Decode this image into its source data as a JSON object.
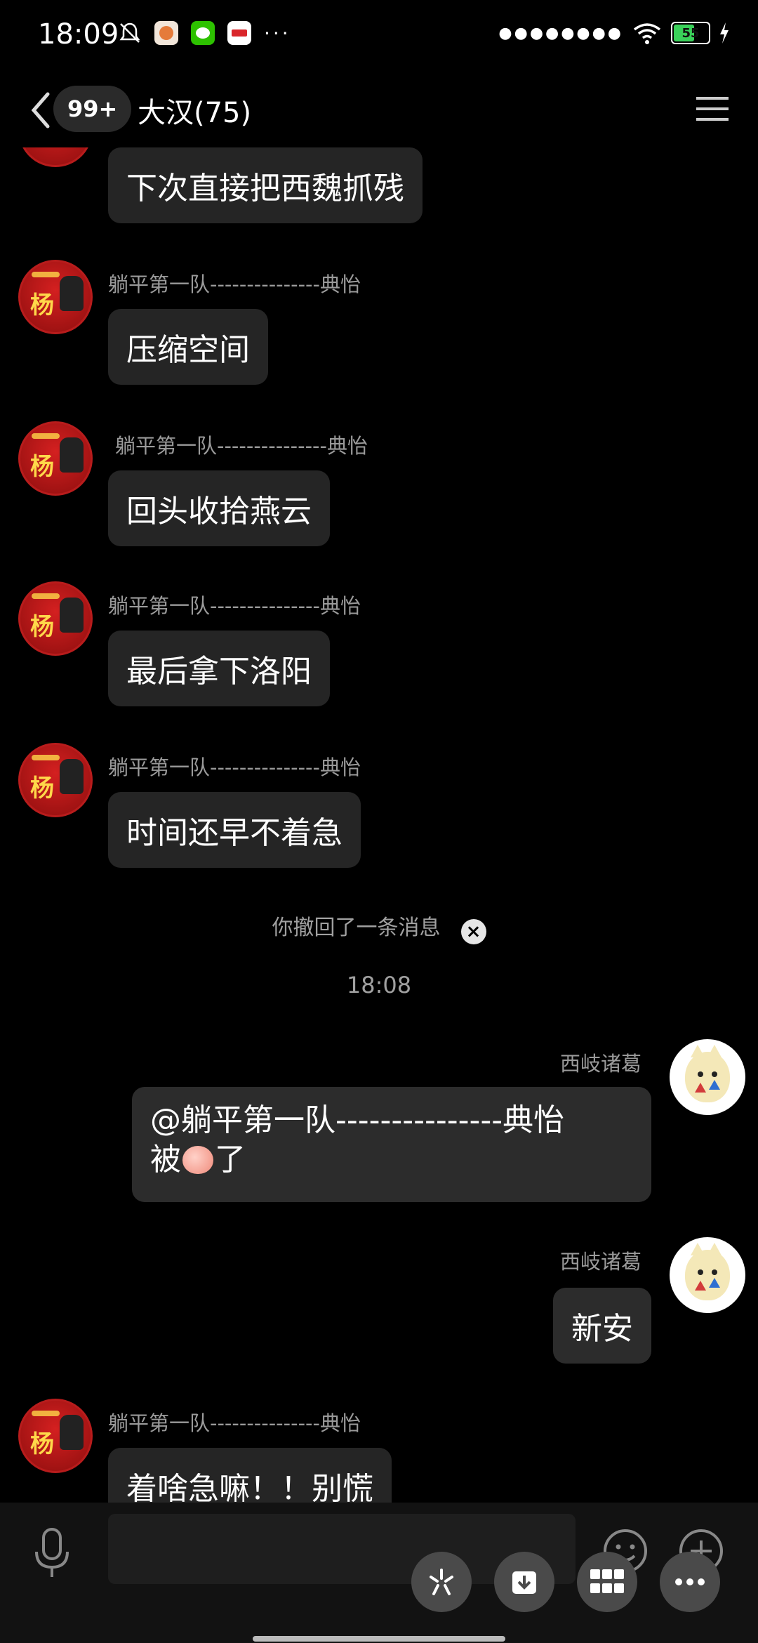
{
  "status_bar": {
    "time": "18:09",
    "battery": "55",
    "colors": {
      "battery_fill": "#3ad15a"
    }
  },
  "header": {
    "unread": "99+",
    "title": "大汉(75)"
  },
  "messages": [
    {
      "sender": "",
      "text": "下次直接把西魏抓残"
    },
    {
      "sender": "躺平第一队---------------典怡",
      "text": "压缩空间"
    },
    {
      "sender": "躺平第一队---------------典怡",
      "text": "回头收拾燕云"
    },
    {
      "sender": "躺平第一队---------------典怡",
      "text": "最后拿下洛阳"
    },
    {
      "sender": "躺平第一队---------------典怡",
      "text": "时间还早不着急"
    }
  ],
  "system": {
    "recall": "你撤回了一条消息",
    "time": "18:08"
  },
  "my_messages": [
    {
      "sender": "西岐诸葛",
      "line1": "@躺平第一队---------------典怡",
      "line2_pre": "被",
      "line2_post": "了"
    },
    {
      "sender": "西岐诸葛",
      "text": "新安"
    }
  ],
  "last_message": {
    "sender": "躺平第一队---------------典怡",
    "text": "着啥急嘛！！别慌"
  }
}
